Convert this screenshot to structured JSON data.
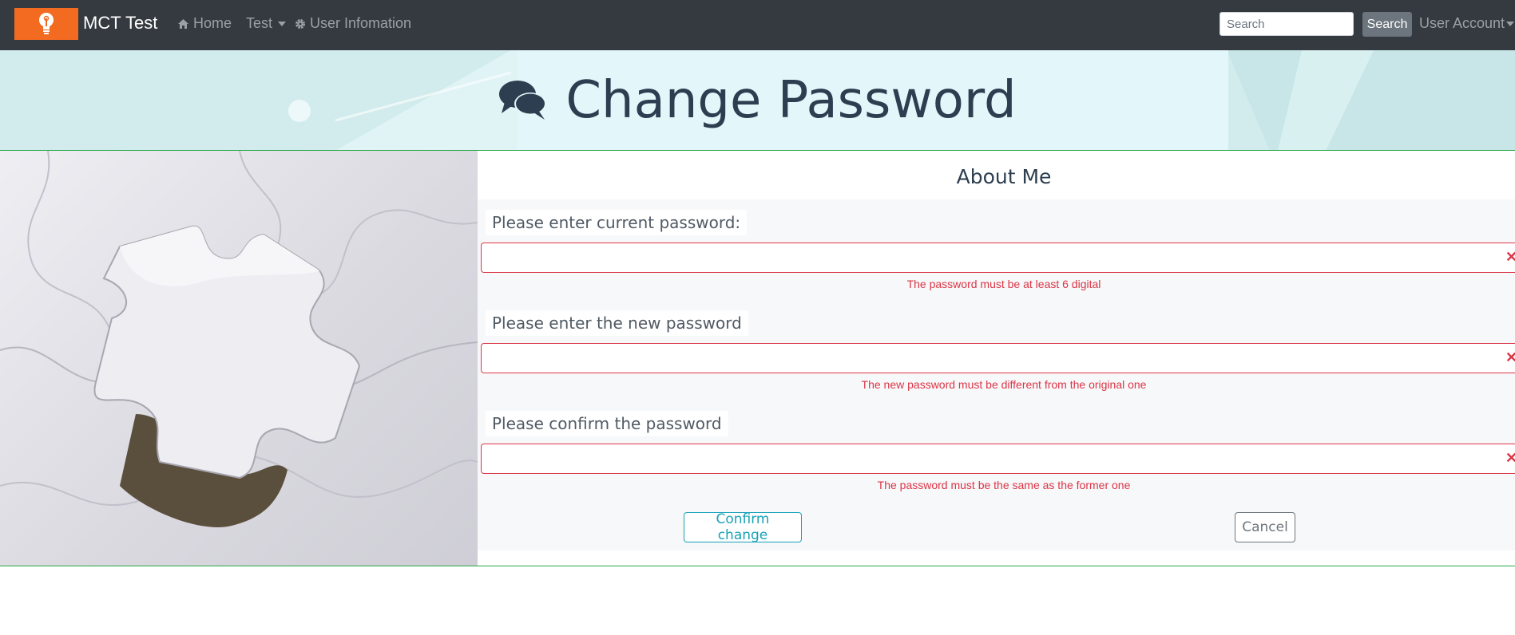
{
  "navbar": {
    "brand": "MCT Test",
    "links": [
      {
        "label": "Home",
        "icon": "home-icon"
      },
      {
        "label": "Test",
        "icon": "chevron-down-icon"
      },
      {
        "label": "User Infomation",
        "icon": "gear-icon"
      }
    ],
    "search": {
      "placeholder": "Search",
      "button_label": "Search"
    },
    "account_label": "User Account"
  },
  "banner": {
    "title": "Change Password",
    "icon": "comments-icon"
  },
  "panel": {
    "heading": "About Me",
    "fields": [
      {
        "label": "Please enter current password:",
        "error": "The password must be at least 6 digital"
      },
      {
        "label": "Please enter the new password",
        "error": "The new password must be different from the original one"
      },
      {
        "label": "Please confirm the password",
        "error": "The password must be the same as the former one"
      }
    ],
    "confirm_label": "Confirm change",
    "cancel_label": "Cancel"
  },
  "colors": {
    "navbar": "#343a40",
    "logo": "#f26b21",
    "error": "#dc3545",
    "confirm": "#17a2b8",
    "cancel": "#6c757d",
    "border_accent": "#28a745"
  }
}
